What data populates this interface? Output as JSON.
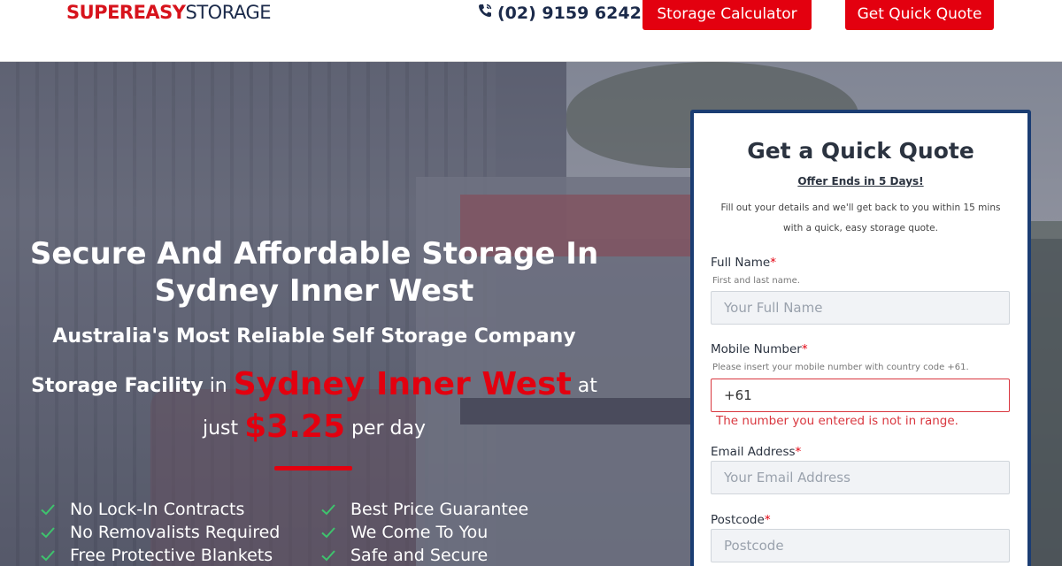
{
  "header": {
    "logo": {
      "part1": "SUPEREASY",
      "part2": "STORAGE"
    },
    "phone": "(02) 9159 6242",
    "calculator_label": "Storage Calculator",
    "quote_label": "Get Quick Quote"
  },
  "hero": {
    "title_line1": "Secure And Affordable Storage In",
    "title_line2": "Sydney Inner West",
    "subtitle": "Australia's Most Reliable Self Storage Company",
    "price": {
      "prefix_bold": "Storage Facility",
      "in": "in",
      "city": "Sydney Inner West",
      "at": "at",
      "just": "just",
      "amount": "$3.25",
      "per": "per day"
    },
    "features_left": [
      "No Lock-In Contracts",
      "No Removalists Required",
      "Free Protective Blankets"
    ],
    "features_right": [
      "Best Price Guarantee",
      "We Come To You",
      "Safe and Secure"
    ]
  },
  "form": {
    "title": "Get a Quick Quote",
    "offer": "Offer Ends in 5 Days!",
    "description": "Fill out your details and we'll get back to you within 15 mins with a quick, easy storage quote.",
    "full_name": {
      "label": "Full Name",
      "required": "*",
      "hint": "First and last name.",
      "placeholder": "Your Full Name"
    },
    "mobile": {
      "label": "Mobile Number",
      "required": "*",
      "hint": "Please insert your mobile number with country code +61.",
      "value": "+61",
      "error": "The number you entered is not in range."
    },
    "email": {
      "label": "Email Address",
      "required": "*",
      "placeholder": "Your Email Address"
    },
    "postcode": {
      "label": "Postcode",
      "required": "*",
      "placeholder": "Postcode"
    }
  },
  "colors": {
    "brand_red": "#e3000f",
    "brand_navy": "#1b3d73",
    "check_green": "#3ec46d"
  }
}
